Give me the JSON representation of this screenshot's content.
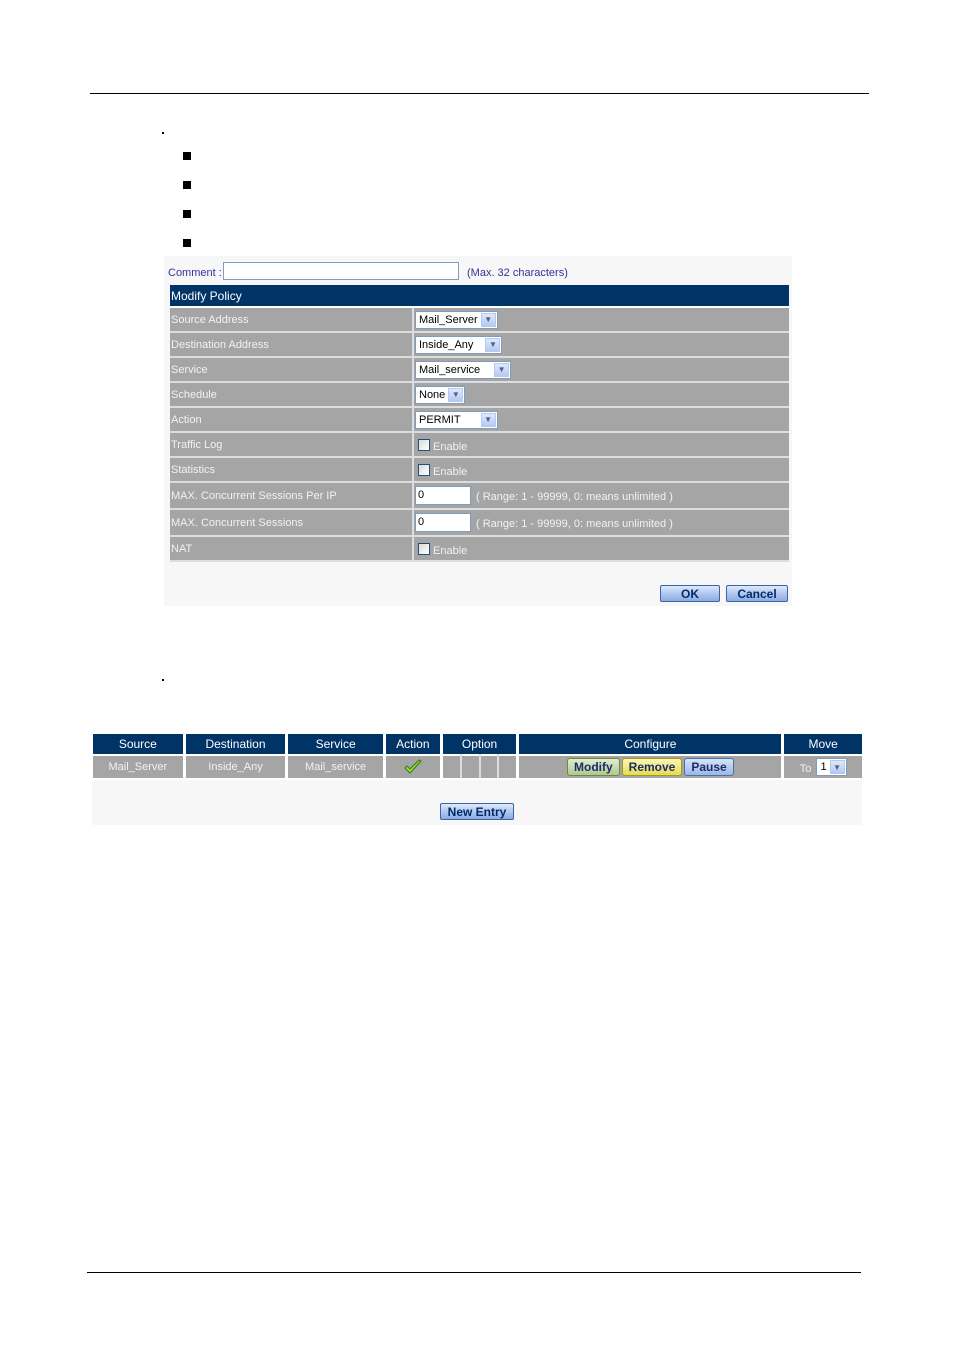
{
  "modify_policy": {
    "comment": {
      "label": "Comment :",
      "value": "",
      "hint": "(Max. 32 characters)"
    },
    "title": "Modify Policy",
    "fields": {
      "source_address": {
        "label": "Source Address",
        "value": "Mail_Server"
      },
      "destination_address": {
        "label": "Destination Address",
        "value": "Inside_Any"
      },
      "service": {
        "label": "Service",
        "value": "Mail_service"
      },
      "schedule": {
        "label": "Schedule",
        "value": "None"
      },
      "action": {
        "label": "Action",
        "value": "PERMIT"
      },
      "traffic_log": {
        "label": "Traffic Log",
        "checkbox_label": "Enable",
        "checked": false
      },
      "statistics": {
        "label": "Statistics",
        "checkbox_label": "Enable",
        "checked": false
      },
      "max_sessions_per_ip": {
        "label": "MAX. Concurrent Sessions Per IP",
        "value": "0",
        "hint": "( Range: 1 - 99999, 0: means unlimited )"
      },
      "max_sessions": {
        "label": "MAX. Concurrent Sessions",
        "value": "0",
        "hint": "( Range: 1 - 99999, 0: means unlimited )"
      },
      "nat": {
        "label": "NAT",
        "checkbox_label": "Enable",
        "checked": false
      }
    },
    "buttons": {
      "ok": "OK",
      "cancel": "Cancel"
    }
  },
  "policy_list": {
    "columns": [
      "Source",
      "Destination",
      "Service",
      "Action",
      "Option",
      "Configure",
      "Move"
    ],
    "rows": [
      {
        "source": "Mail_Server",
        "destination": "Inside_Any",
        "service": "Mail_service",
        "action_icon": "check-icon",
        "configure": {
          "modify": "Modify",
          "remove": "Remove",
          "pause": "Pause"
        },
        "move": {
          "label": "To",
          "value": "1"
        }
      }
    ],
    "new_entry": "New Entry"
  },
  "colors": {
    "header": "#003366",
    "row": "#a5a5a5",
    "label_text": "#33339a"
  }
}
